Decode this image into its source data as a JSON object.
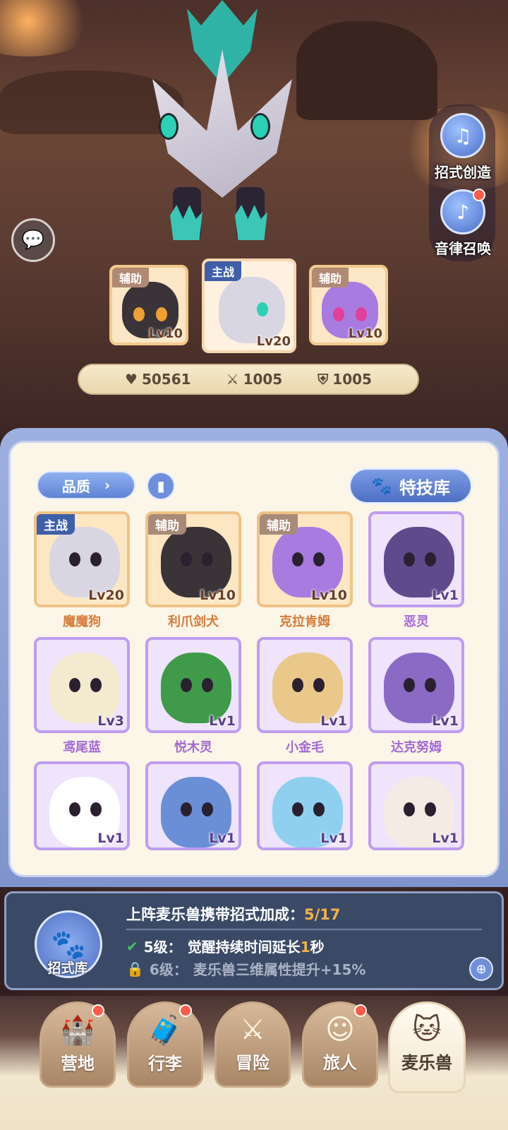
{
  "side_buttons": {
    "skill_create": "招式创造",
    "rhythm_summon": "音律召唤"
  },
  "team": {
    "slots": [
      {
        "role": "辅助",
        "level": "Lv10",
        "species": "利爪剑犬"
      },
      {
        "role": "主战",
        "level": "Lv20",
        "species": "魔魔狗"
      },
      {
        "role": "辅助",
        "level": "Lv10",
        "species": "克拉肯姆"
      }
    ]
  },
  "stats": {
    "hp": "50561",
    "attack": "1005",
    "defense": "1005"
  },
  "panel": {
    "quality_filter": "品质",
    "skill_library": "特技库"
  },
  "pets": [
    {
      "name": "魔魔狗",
      "level": "Lv20",
      "role": "主战",
      "rarity": "orange",
      "color": "#d9d6e4"
    },
    {
      "name": "利爪剑犬",
      "level": "Lv10",
      "role": "辅助",
      "rarity": "orange",
      "color": "#3a3438"
    },
    {
      "name": "克拉肯姆",
      "level": "Lv10",
      "role": "辅助",
      "rarity": "orange",
      "color": "#a77be0"
    },
    {
      "name": "恶灵",
      "level": "Lv1",
      "role": "",
      "rarity": "purple",
      "color": "#5e4a8c"
    },
    {
      "name": "鸢尾蓝",
      "level": "Lv3",
      "role": "",
      "rarity": "purple",
      "color": "#f3ead0"
    },
    {
      "name": "悦木灵",
      "level": "Lv1",
      "role": "",
      "rarity": "purple",
      "color": "#3f9a4a"
    },
    {
      "name": "小金毛",
      "level": "Lv1",
      "role": "",
      "rarity": "purple",
      "color": "#e9c88a"
    },
    {
      "name": "达克努姆",
      "level": "Lv1",
      "role": "",
      "rarity": "purple",
      "color": "#8a6ac4"
    },
    {
      "name": "",
      "level": "Lv1",
      "role": "",
      "rarity": "purple",
      "color": "#ffffff"
    },
    {
      "name": "",
      "level": "Lv1",
      "role": "",
      "rarity": "purple",
      "color": "#6b8fd6"
    },
    {
      "name": "",
      "level": "Lv1",
      "role": "",
      "rarity": "purple",
      "color": "#8fd0f0"
    },
    {
      "name": "",
      "level": "Lv1",
      "role": "",
      "rarity": "purple",
      "color": "#f4ece4"
    }
  ],
  "bonus": {
    "badge_label": "招式库",
    "title": "上阵麦乐兽携带招式加成：",
    "count": "5/17",
    "unlocked": {
      "level": "5级：",
      "text": "觉醒持续时间延长",
      "value": "1",
      "unit": "秒"
    },
    "locked": {
      "level": "6级：",
      "text": "麦乐兽三维属性提升+15%"
    }
  },
  "nav": {
    "tabs": [
      "营地",
      "行李",
      "冒险",
      "旅人",
      "麦乐兽"
    ]
  }
}
